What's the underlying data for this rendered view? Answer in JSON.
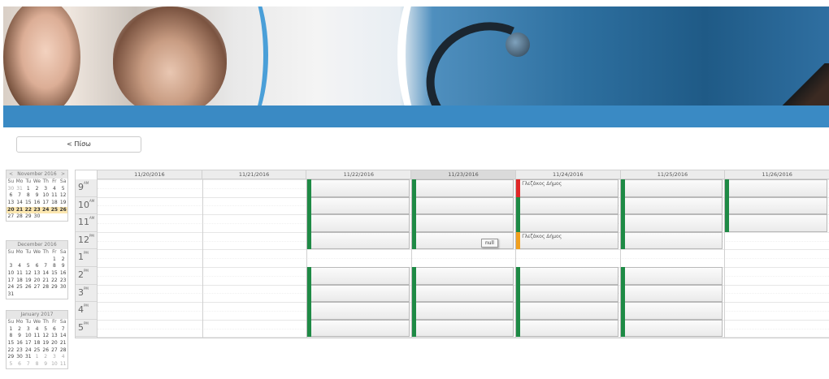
{
  "header": {
    "banner_alt": "medical-banner"
  },
  "back_button": {
    "label": "< Πίσω"
  },
  "mini_calendars": [
    {
      "title": "November 2016",
      "prev": "<",
      "next": ">",
      "dow": [
        "Su",
        "Mo",
        "Tu",
        "We",
        "Th",
        "Fr",
        "Sa"
      ],
      "days": [
        {
          "d": "30",
          "o": true
        },
        {
          "d": "31",
          "o": true
        },
        {
          "d": "1"
        },
        {
          "d": "2"
        },
        {
          "d": "3"
        },
        {
          "d": "4"
        },
        {
          "d": "5"
        },
        {
          "d": "6"
        },
        {
          "d": "7"
        },
        {
          "d": "8"
        },
        {
          "d": "9"
        },
        {
          "d": "10"
        },
        {
          "d": "11"
        },
        {
          "d": "12"
        },
        {
          "d": "13"
        },
        {
          "d": "14"
        },
        {
          "d": "15"
        },
        {
          "d": "16"
        },
        {
          "d": "17"
        },
        {
          "d": "18"
        },
        {
          "d": "19"
        },
        {
          "d": "20",
          "h": true
        },
        {
          "d": "21",
          "h": true
        },
        {
          "d": "22",
          "h": true
        },
        {
          "d": "23",
          "h": true
        },
        {
          "d": "24",
          "h": true
        },
        {
          "d": "25",
          "h": true
        },
        {
          "d": "26",
          "h": true
        },
        {
          "d": "27"
        },
        {
          "d": "28"
        },
        {
          "d": "29"
        },
        {
          "d": "30"
        },
        {
          "d": ""
        },
        {
          "d": ""
        },
        {
          "d": ""
        }
      ]
    },
    {
      "title": "December 2016",
      "prev": "",
      "next": "",
      "dow": [
        "Su",
        "Mo",
        "Tu",
        "We",
        "Th",
        "Fr",
        "Sa"
      ],
      "days": [
        {
          "d": ""
        },
        {
          "d": ""
        },
        {
          "d": ""
        },
        {
          "d": ""
        },
        {
          "d": ""
        },
        {
          "d": "1"
        },
        {
          "d": "2"
        },
        {
          "d": "3"
        },
        {
          "d": "4"
        },
        {
          "d": "5"
        },
        {
          "d": "6"
        },
        {
          "d": "7"
        },
        {
          "d": "8"
        },
        {
          "d": "9"
        },
        {
          "d": "10"
        },
        {
          "d": "11"
        },
        {
          "d": "12"
        },
        {
          "d": "13"
        },
        {
          "d": "14"
        },
        {
          "d": "15"
        },
        {
          "d": "16"
        },
        {
          "d": "17"
        },
        {
          "d": "18"
        },
        {
          "d": "19"
        },
        {
          "d": "20"
        },
        {
          "d": "21"
        },
        {
          "d": "22"
        },
        {
          "d": "23"
        },
        {
          "d": "24"
        },
        {
          "d": "25"
        },
        {
          "d": "26"
        },
        {
          "d": "27"
        },
        {
          "d": "28"
        },
        {
          "d": "29"
        },
        {
          "d": "30"
        },
        {
          "d": "31"
        }
      ]
    },
    {
      "title": "January 2017",
      "prev": "",
      "next": "",
      "dow": [
        "Su",
        "Mo",
        "Tu",
        "We",
        "Th",
        "Fr",
        "Sa"
      ],
      "days": [
        {
          "d": "1"
        },
        {
          "d": "2"
        },
        {
          "d": "3"
        },
        {
          "d": "4"
        },
        {
          "d": "5"
        },
        {
          "d": "6"
        },
        {
          "d": "7"
        },
        {
          "d": "8"
        },
        {
          "d": "9"
        },
        {
          "d": "10"
        },
        {
          "d": "11"
        },
        {
          "d": "12"
        },
        {
          "d": "13"
        },
        {
          "d": "14"
        },
        {
          "d": "15"
        },
        {
          "d": "16"
        },
        {
          "d": "17"
        },
        {
          "d": "18"
        },
        {
          "d": "19"
        },
        {
          "d": "20"
        },
        {
          "d": "21"
        },
        {
          "d": "22"
        },
        {
          "d": "23"
        },
        {
          "d": "24"
        },
        {
          "d": "25"
        },
        {
          "d": "26"
        },
        {
          "d": "27"
        },
        {
          "d": "28"
        },
        {
          "d": "29"
        },
        {
          "d": "30"
        },
        {
          "d": "31"
        },
        {
          "d": "1",
          "o": true
        },
        {
          "d": "2",
          "o": true
        },
        {
          "d": "3",
          "o": true
        },
        {
          "d": "4",
          "o": true
        },
        {
          "d": "5",
          "o": true
        },
        {
          "d": "6",
          "o": true
        },
        {
          "d": "7",
          "o": true
        },
        {
          "d": "8",
          "o": true
        },
        {
          "d": "9",
          "o": true
        },
        {
          "d": "10",
          "o": true
        },
        {
          "d": "11",
          "o": true
        }
      ]
    }
  ],
  "scheduler": {
    "columns": [
      "11/20/2016",
      "11/21/2016",
      "11/22/2016",
      "11/23/2016",
      "11/24/2016",
      "11/25/2016",
      "11/26/2016"
    ],
    "today_index": 3,
    "hours": [
      {
        "h": "9",
        "ap": "AM"
      },
      {
        "h": "10",
        "ap": "AM"
      },
      {
        "h": "11",
        "ap": "AM"
      },
      {
        "h": "12",
        "ap": "PM"
      },
      {
        "h": "1",
        "ap": "PM"
      },
      {
        "h": "2",
        "ap": "PM"
      },
      {
        "h": "3",
        "ap": "PM"
      },
      {
        "h": "4",
        "ap": "PM"
      },
      {
        "h": "5",
        "ap": "PM"
      }
    ],
    "status_colors": {
      "available": "#1e8a45",
      "booked": "#e02828",
      "pending": "#f0a020"
    },
    "slots": [
      {
        "day": 2,
        "hour": 0,
        "status": "available",
        "text": ""
      },
      {
        "day": 2,
        "hour": 1,
        "status": "available",
        "text": ""
      },
      {
        "day": 2,
        "hour": 2,
        "status": "available",
        "text": ""
      },
      {
        "day": 2,
        "hour": 3,
        "status": "available",
        "text": ""
      },
      {
        "day": 2,
        "hour": 5,
        "status": "available",
        "text": ""
      },
      {
        "day": 2,
        "hour": 6,
        "status": "available",
        "text": ""
      },
      {
        "day": 2,
        "hour": 7,
        "status": "available",
        "text": ""
      },
      {
        "day": 2,
        "hour": 8,
        "status": "available",
        "text": ""
      },
      {
        "day": 3,
        "hour": 0,
        "status": "available",
        "text": ""
      },
      {
        "day": 3,
        "hour": 1,
        "status": "available",
        "text": ""
      },
      {
        "day": 3,
        "hour": 2,
        "status": "available",
        "text": ""
      },
      {
        "day": 3,
        "hour": 3,
        "status": "available",
        "text": ""
      },
      {
        "day": 3,
        "hour": 5,
        "status": "available",
        "text": ""
      },
      {
        "day": 3,
        "hour": 6,
        "status": "available",
        "text": ""
      },
      {
        "day": 3,
        "hour": 7,
        "status": "available",
        "text": ""
      },
      {
        "day": 3,
        "hour": 8,
        "status": "available",
        "text": ""
      },
      {
        "day": 4,
        "hour": 0,
        "status": "booked",
        "text": "Γλεζάκος Δήμος"
      },
      {
        "day": 4,
        "hour": 1,
        "status": "available",
        "text": ""
      },
      {
        "day": 4,
        "hour": 2,
        "status": "available",
        "text": ""
      },
      {
        "day": 4,
        "hour": 3,
        "status": "pending",
        "text": "Γλεζάκος Δήμος"
      },
      {
        "day": 4,
        "hour": 5,
        "status": "available",
        "text": ""
      },
      {
        "day": 4,
        "hour": 6,
        "status": "available",
        "text": ""
      },
      {
        "day": 4,
        "hour": 7,
        "status": "available",
        "text": ""
      },
      {
        "day": 4,
        "hour": 8,
        "status": "available",
        "text": ""
      },
      {
        "day": 5,
        "hour": 0,
        "status": "available",
        "text": ""
      },
      {
        "day": 5,
        "hour": 1,
        "status": "available",
        "text": ""
      },
      {
        "day": 5,
        "hour": 2,
        "status": "available",
        "text": ""
      },
      {
        "day": 5,
        "hour": 3,
        "status": "available",
        "text": ""
      },
      {
        "day": 5,
        "hour": 5,
        "status": "available",
        "text": ""
      },
      {
        "day": 5,
        "hour": 6,
        "status": "available",
        "text": ""
      },
      {
        "day": 5,
        "hour": 7,
        "status": "available",
        "text": ""
      },
      {
        "day": 5,
        "hour": 8,
        "status": "available",
        "text": ""
      },
      {
        "day": 6,
        "hour": 0,
        "status": "available",
        "text": ""
      },
      {
        "day": 6,
        "hour": 1,
        "status": "available",
        "text": ""
      },
      {
        "day": 6,
        "hour": 2,
        "status": "available",
        "text": ""
      }
    ],
    "tooltip": "null"
  }
}
